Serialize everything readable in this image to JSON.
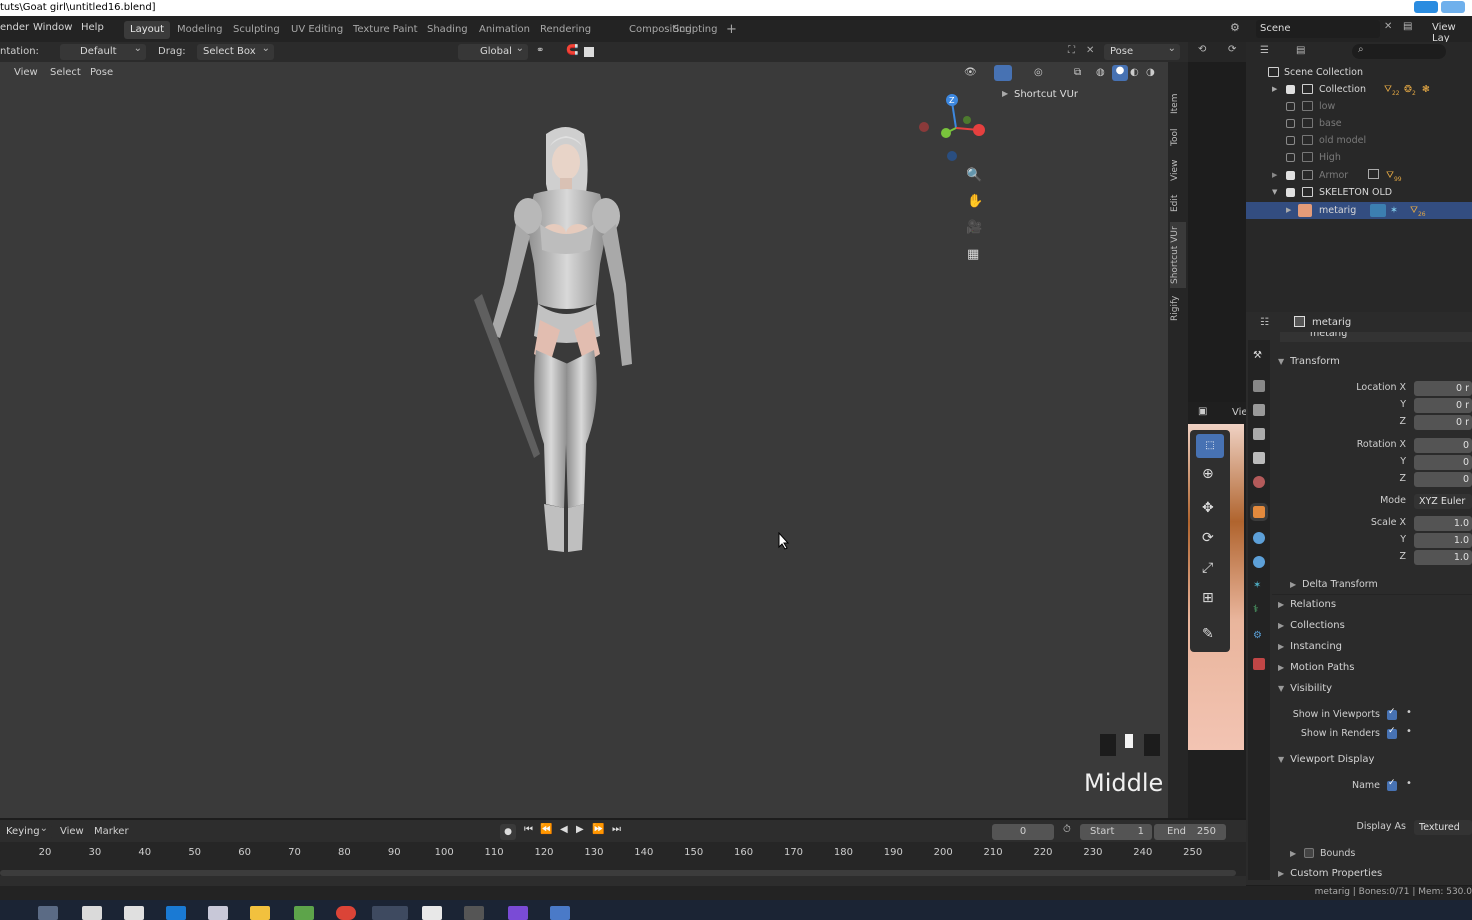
{
  "title": "tuts\\Goat girl\\untitled16.blend]",
  "menu": [
    "ender",
    "Window",
    "Help"
  ],
  "workspaces": [
    "Layout",
    "Modeling",
    "Sculpting",
    "UV Editing",
    "Texture Paint",
    "Shading",
    "Animation",
    "Rendering",
    "Compositing",
    "Scripting",
    "+"
  ],
  "scene": {
    "scene_label": "Scene",
    "view_layer": "View Lay"
  },
  "header": {
    "orientation_label": "ntation:",
    "orientation_value": "Default",
    "drag_label": "Drag:",
    "drag_value": "Select Box",
    "transform_value": "Global",
    "pose_options": "Pose Options"
  },
  "viewport": {
    "menu": [
      "View",
      "Select",
      "Pose"
    ],
    "npanel_title": "Shortcut VUr",
    "overlay_text": "Middle",
    "side_tabs": [
      "Item",
      "Tool",
      "View",
      "Edit",
      "Shortcut VUr",
      "Rigify"
    ]
  },
  "outliner": {
    "items": [
      {
        "label": "Scene Collection",
        "checked": null,
        "dim": false
      },
      {
        "label": "Collection",
        "checked": true,
        "dim": false
      },
      {
        "label": "low",
        "checked": false,
        "dim": true
      },
      {
        "label": "base",
        "checked": false,
        "dim": true
      },
      {
        "label": "old model",
        "checked": false,
        "dim": true
      },
      {
        "label": "High",
        "checked": false,
        "dim": true
      },
      {
        "label": "Armor",
        "checked": true,
        "dim": true
      },
      {
        "label": "SKELETON OLD",
        "checked": true,
        "dim": false
      },
      {
        "label": "metarig",
        "checked": null,
        "dim": false,
        "selected": true
      }
    ],
    "badges": {
      "collection_a": "22",
      "collection_b": "2",
      "armor": "99",
      "metarig": "26"
    }
  },
  "properties": {
    "object_name": "metarig",
    "object_name_field": "metarig",
    "transform_title": "Transform",
    "location": {
      "label_x": "Location X",
      "label_y": "Y",
      "label_z": "Z",
      "x": "0 r",
      "y": "0 r",
      "z": "0 r"
    },
    "rotation": {
      "label_x": "Rotation X",
      "label_y": "Y",
      "label_z": "Z",
      "x": "0",
      "y": "0",
      "z": "0"
    },
    "mode_label": "Mode",
    "mode_value": "XYZ Euler",
    "scale": {
      "label_x": "Scale X",
      "label_y": "Y",
      "label_z": "Z",
      "x": "1.0",
      "y": "1.0",
      "z": "1.0"
    },
    "sections": [
      "Delta Transform",
      "Relations",
      "Collections",
      "Instancing",
      "Motion Paths"
    ],
    "visibility_title": "Visibility",
    "show_in_viewports": "Show in Viewports",
    "show_in_renders": "Show in Renders",
    "viewport_display_title": "Viewport Display",
    "name_label": "Name",
    "display_as_label": "Display As",
    "display_as_value": "Textured",
    "bounds_label": "Bounds",
    "custom_properties": "Custom Properties"
  },
  "timeline": {
    "menu": [
      "Keying",
      "View",
      "Marker"
    ],
    "current_frame": "0",
    "start_label": "Start",
    "start_value": "1",
    "end_label": "End",
    "end_value": "250",
    "ticks": [
      "20",
      "30",
      "40",
      "50",
      "60",
      "70",
      "80",
      "90",
      "100",
      "110",
      "120",
      "130",
      "140",
      "150",
      "160",
      "170",
      "180",
      "190",
      "200",
      "210",
      "220",
      "230",
      "240",
      "250"
    ]
  },
  "statusbar": {
    "text": "metarig | Bones:0/71 | Mem: 530.0"
  },
  "imgpanel": {
    "label": "Vie"
  },
  "colors": {
    "accent": "#4772b3",
    "x_axis": "#e5403f",
    "y_axis": "#79c33c",
    "z_axis": "#3d88e0"
  }
}
